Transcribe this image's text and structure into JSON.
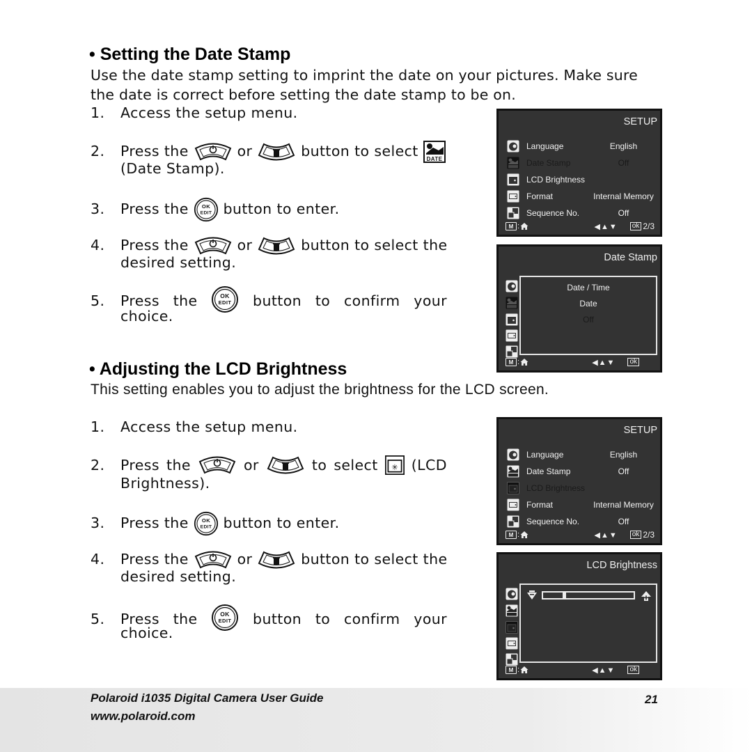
{
  "section1": {
    "heading": "• Setting the Date Stamp",
    "intro_line1": "Use the date stamp setting to imprint the date on your pictures. Make sure",
    "intro_line2": "the date is correct before setting the date stamp to be on.",
    "steps": [
      {
        "num": "1.",
        "text": "Access the setup menu."
      },
      {
        "num": "2.",
        "pre": "Press the",
        "mid": "or",
        "post": "button to select",
        "cont": "(Date Stamp)."
      },
      {
        "num": "3.",
        "pre": "Press the",
        "post": "button to enter."
      },
      {
        "num": "4.",
        "pre": "Press the",
        "mid": "or",
        "post": "button to select the",
        "cont": "desired setting."
      },
      {
        "num": "5.",
        "words": [
          "Press",
          "the",
          "button",
          "to",
          "confirm",
          "your"
        ],
        "cont": "choice."
      }
    ]
  },
  "section2": {
    "heading": "• Adjusting the LCD Brightness",
    "intro": "This setting enables you to adjust the brightness for the LCD screen.",
    "steps": [
      {
        "num": "1.",
        "text": "Access the setup menu."
      },
      {
        "num": "2.",
        "words": [
          "Press",
          "the",
          "or",
          "to",
          "select",
          "(LCD"
        ],
        "cont": "Brightness)."
      },
      {
        "num": "3.",
        "pre": "Press the",
        "post": "button to enter."
      },
      {
        "num": "4.",
        "pre": "Press the",
        "mid": "or",
        "post": "button to select the",
        "cont": "desired setting."
      },
      {
        "num": "5.",
        "words": [
          "Press",
          "the",
          "button",
          "to",
          "confirm",
          "your"
        ],
        "cont": "choice."
      }
    ]
  },
  "buttons": {
    "ok_edit_top": "OK",
    "ok_edit_bottom": "EDIT",
    "date_icon_label": "DATE"
  },
  "screens": {
    "setup_title": "SETUP",
    "setup_menu": [
      {
        "icon": "language-icon",
        "label": "Language",
        "value": "English"
      },
      {
        "icon": "date-stamp-icon",
        "label": "Date Stamp",
        "value": "Off"
      },
      {
        "icon": "lcd-brightness-icon",
        "label": "LCD Brightness",
        "value": ""
      },
      {
        "icon": "format-icon",
        "label": "Format",
        "value": "Internal Memory"
      },
      {
        "icon": "sequence-icon",
        "label": "Sequence No.",
        "value": "Off"
      }
    ],
    "screen1_selected": "Date Stamp",
    "screen3_selected": "LCD Brightness",
    "footer_m": "M",
    "footer_nav": "◀▲▼",
    "footer_ok": "ok",
    "footer_page": "2/3",
    "date_stamp_title": "Date Stamp",
    "date_stamp_options": [
      "Date / Time",
      "Date",
      "Off"
    ],
    "date_stamp_selected": "Off",
    "lcd_title": "LCD Brightness",
    "lcd_brightness_level": 0.22
  },
  "footer": {
    "guide_title": "Polaroid i1035 Digital Camera User Guide",
    "website": "www.polaroid.com",
    "page_number": "21"
  }
}
